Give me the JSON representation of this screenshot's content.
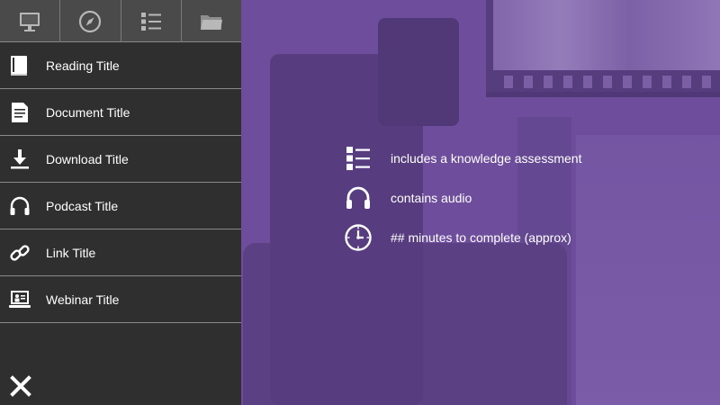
{
  "tabs": [
    {
      "icon": "monitor-icon"
    },
    {
      "icon": "compass-icon"
    },
    {
      "icon": "list-icon"
    },
    {
      "icon": "folder-icon"
    }
  ],
  "menu": {
    "items": [
      {
        "icon": "book-icon",
        "label": "Reading Title"
      },
      {
        "icon": "document-icon",
        "label": "Document Title"
      },
      {
        "icon": "download-icon",
        "label": "Download Title"
      },
      {
        "icon": "headphones-icon",
        "label": "Podcast Title"
      },
      {
        "icon": "link-icon",
        "label": "Link Title"
      },
      {
        "icon": "webinar-icon",
        "label": "Webinar Title"
      }
    ]
  },
  "legend": {
    "items": [
      {
        "icon": "list-icon",
        "text": "includes a knowledge assessment"
      },
      {
        "icon": "headphones-icon",
        "text": "contains audio"
      },
      {
        "icon": "clock-icon",
        "text": "## minutes to complete (approx)"
      }
    ]
  },
  "colors": {
    "sidebar_bg": "#2f2f2f",
    "tabbar_bg": "#4a4a4a",
    "overlay_purple": "#6e4fa0",
    "text": "#ffffff"
  },
  "close": {
    "icon": "close-icon"
  }
}
